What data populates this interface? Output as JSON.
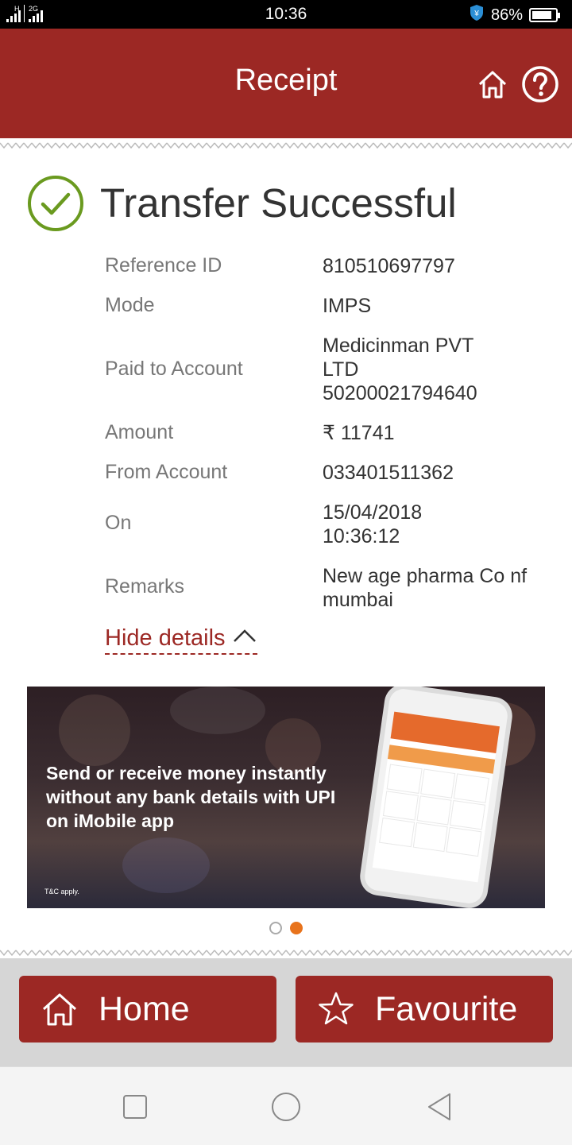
{
  "status_bar": {
    "network_primary": "H",
    "network_secondary": "2G",
    "time": "10:36",
    "battery_percent": "86%",
    "battery_level": 0.86,
    "icons": [
      "signal-icon",
      "shield-icon",
      "battery-icon"
    ]
  },
  "header": {
    "title": "Receipt",
    "icons": [
      "home-icon",
      "help-icon"
    ]
  },
  "receipt": {
    "status": "Transfer Successful",
    "details": [
      {
        "label": "Reference ID",
        "value": "810510697797"
      },
      {
        "label": "Mode",
        "value": "IMPS"
      },
      {
        "label": "Paid to Account",
        "value": "Medicinman PVT LTD 50200021794640"
      },
      {
        "label": "Amount",
        "value": "₹ 11741"
      },
      {
        "label": "From Account",
        "value": "033401511362"
      },
      {
        "label": "On",
        "value": "15/04/2018 10:36:12"
      },
      {
        "label": "Remarks",
        "value": "New age pharma Co nf mumbai"
      }
    ],
    "toggle_label": "Hide details"
  },
  "banner": {
    "headline": "Send or receive money instantly without any bank details with UPI on iMobile app",
    "fine_print": "T&C apply.",
    "slide_count": 2,
    "active_slide": 2
  },
  "footer": {
    "home_label": "Home",
    "favourite_label": "Favourite"
  },
  "colors": {
    "brand": "#9c2824",
    "success": "#6a9a1f",
    "carousel_active": "#e8731c"
  }
}
